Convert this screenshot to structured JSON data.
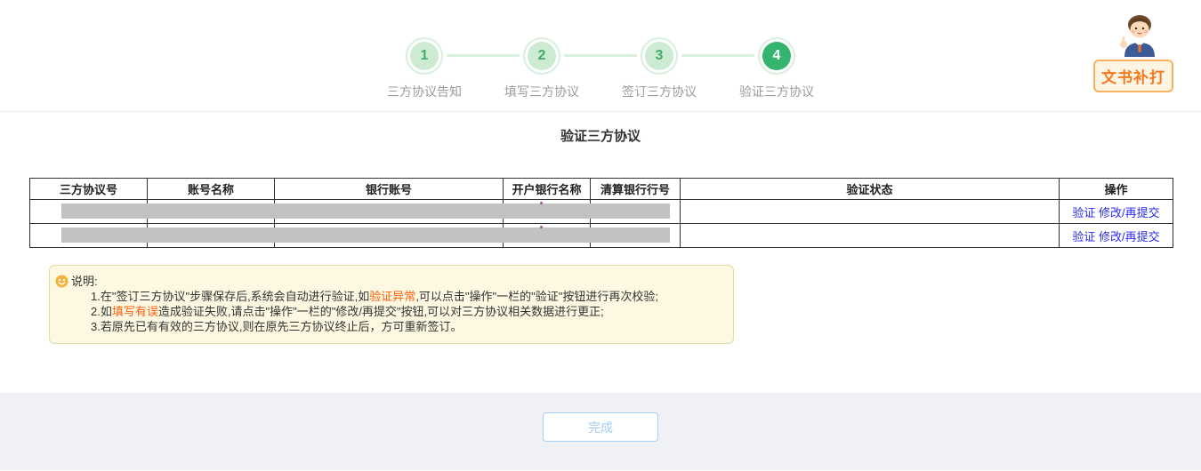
{
  "stepper": {
    "steps": [
      {
        "num": "1",
        "label": "三方协议告知",
        "active": false
      },
      {
        "num": "2",
        "label": "填写三方协议",
        "active": false
      },
      {
        "num": "3",
        "label": "签订三方协议",
        "active": false
      },
      {
        "num": "4",
        "label": "验证三方协议",
        "active": true
      }
    ]
  },
  "helper": {
    "badge_label": "文书补打"
  },
  "page_title": "验证三方协议",
  "table": {
    "headers": [
      "三方协议号",
      "账号名称",
      "银行账号",
      "开户银行名称",
      "清算银行行号",
      "验证状态",
      "操作"
    ],
    "rows": [
      {
        "redacted": true,
        "verify_status": "",
        "actions": [
          "验证",
          "修改/再提交"
        ]
      },
      {
        "redacted": true,
        "verify_status": "",
        "actions": [
          "验证",
          "修改/再提交"
        ]
      }
    ]
  },
  "note": {
    "title": "说明:",
    "lines": [
      {
        "pre": "1.在\"签订三方协议\"步骤保存后,系统会自动进行验证,如",
        "em": "验证异常",
        "post": ",可以点击\"操作\"一栏的\"验证\"按钮进行再次校验;"
      },
      {
        "pre": "2.如",
        "em": "填写有误",
        "post": "造成验证失败,请点击\"操作\"一栏的\"修改/再提交\"按钮,可以对三方协议相关数据进行更正;"
      },
      {
        "pre": "3.若原先已有有效的三方协议,则在原先三方协议终止后，方可重新签订。",
        "em": "",
        "post": ""
      }
    ]
  },
  "footer": {
    "finish_label": "完成"
  },
  "colors": {
    "step_active": "#35b470",
    "step_inactive_fill": "#cdebd3",
    "step_ring": "#d7f0dd",
    "link_blue": "#2a2aee",
    "note_bg": "#fdf8e1",
    "note_border": "#e6dca8",
    "note_em": "#f95d0a",
    "badge_border": "#f8b25c",
    "badge_text": "#f4791f",
    "redact_gray": "#c2c2c2",
    "footer_bg": "#eff1f4",
    "finish_border": "#a3d0f7"
  }
}
